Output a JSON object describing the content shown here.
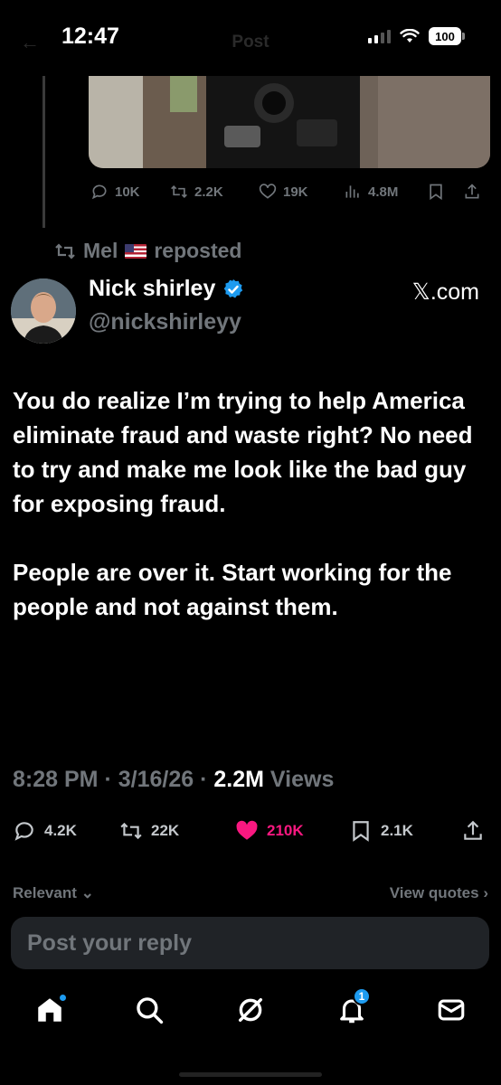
{
  "status_bar": {
    "time": "12:47",
    "battery": "100",
    "header_title": "Post"
  },
  "previous_post": {
    "actions": {
      "replies": "10K",
      "reposts": "2.2K",
      "likes": "19K",
      "views": "4.8M"
    }
  },
  "repost_line": {
    "reposter": "Mel",
    "label": "reposted"
  },
  "post": {
    "author_name": "Nick shirley",
    "handle": "@nickshirleyy",
    "source": "𝕏.com",
    "text_paragraphs": [
      "You do realize I’m trying to help America eliminate fraud and waste right? No need to try and make me look like the bad guy for exposing fraud.",
      "People are over it. Start working for the people and not against them."
    ],
    "time": "8:28 PM",
    "date": "3/16/26",
    "views_count": "2.2M",
    "views_label": "Views",
    "stats": {
      "replies": "4.2K",
      "reposts": "22K",
      "likes": "210K",
      "bookmarks": "2.1K"
    }
  },
  "replies_bar": {
    "sort_label": "Relevant",
    "view_quotes_label": "View quotes"
  },
  "reply_box": {
    "placeholder": "Post your reply"
  },
  "bottom_nav": {
    "notification_badge": "1",
    "accent_color": "#1d9bf0",
    "like_color": "#f91880"
  }
}
